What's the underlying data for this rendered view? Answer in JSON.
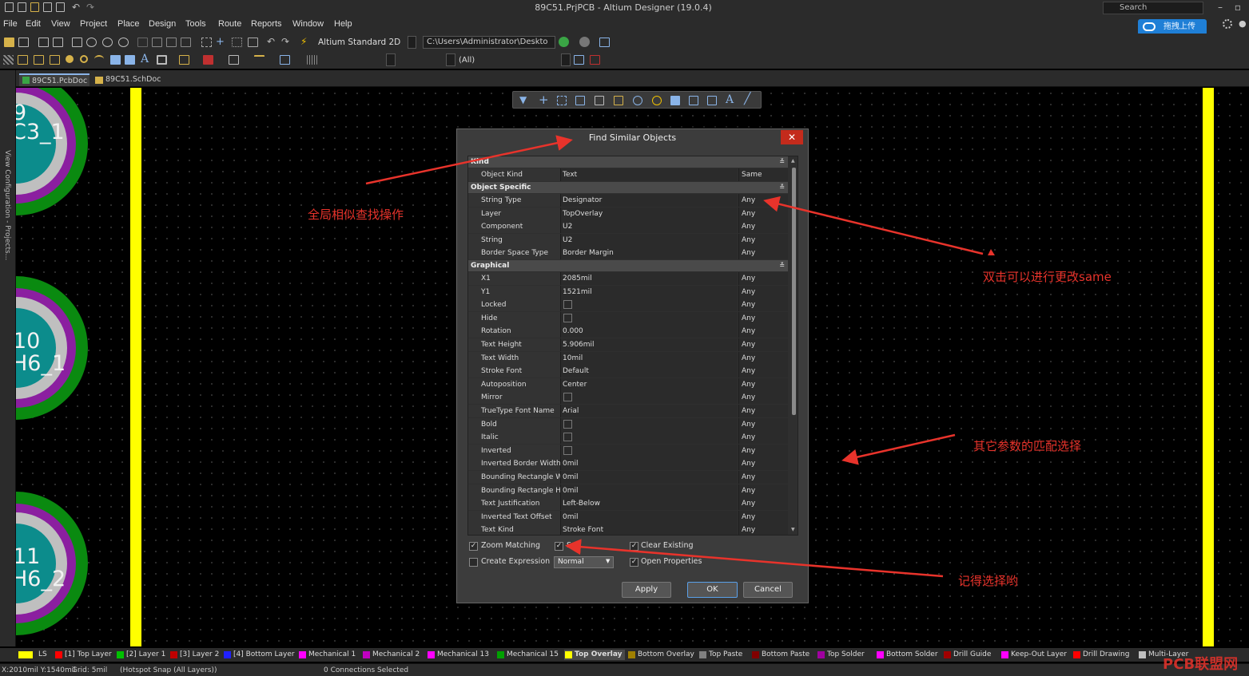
{
  "window": {
    "title": "89C51.PrjPCB - Altium Designer (19.0.4)",
    "search_placeholder": "Search",
    "cloud_button": "拖拽上传"
  },
  "menu": [
    "File",
    "Edit",
    "View",
    "Project",
    "Place",
    "Design",
    "Tools",
    "Route",
    "Reports",
    "Window",
    "Help"
  ],
  "toolbar": {
    "view_mode": "Altium Standard 2D",
    "path": "C:\\Users\\Administrator\\Deskto",
    "filter": "(All)"
  },
  "tabs": [
    "89C51.PcbDoc *",
    "89C51.SchDoc"
  ],
  "side_panel": {
    "label": "View Configuration - Projects..."
  },
  "pads": [
    {
      "line1": "9",
      "line2": "C3_1"
    },
    {
      "line1": "10",
      "line2": "H6_1"
    },
    {
      "line1": "11",
      "line2": "H6_2"
    }
  ],
  "dialog": {
    "title": "Find Similar Objects",
    "close": "✕",
    "sections": {
      "kind": "Kind",
      "specific": "Object Specific",
      "graphical": "Graphical"
    },
    "kind_rows": [
      {
        "label": "Object Kind",
        "value": "Text",
        "match": "Same"
      }
    ],
    "specific_rows": [
      {
        "label": "String Type",
        "value": "Designator",
        "match": "Any"
      },
      {
        "label": "Layer",
        "value": "TopOverlay",
        "match": "Any"
      },
      {
        "label": "Component",
        "value": "U2",
        "match": "Any"
      },
      {
        "label": "String",
        "value": "U2",
        "match": "Any"
      },
      {
        "label": "Border Space Type",
        "value": "Border Margin",
        "match": "Any"
      }
    ],
    "graphical_rows": [
      {
        "label": "X1",
        "value": "2085mil",
        "match": "Any"
      },
      {
        "label": "Y1",
        "value": "1521mil",
        "match": "Any"
      },
      {
        "label": "Locked",
        "value": "",
        "match": "Any"
      },
      {
        "label": "Hide",
        "value": "",
        "match": "Any"
      },
      {
        "label": "Rotation",
        "value": "0.000",
        "match": "Any"
      },
      {
        "label": "Text Height",
        "value": "5.906mil",
        "match": "Any"
      },
      {
        "label": "Text Width",
        "value": "10mil",
        "match": "Any"
      },
      {
        "label": "Stroke Font",
        "value": "Default",
        "match": "Any"
      },
      {
        "label": "Autoposition",
        "value": "Center",
        "match": "Any"
      },
      {
        "label": "Mirror",
        "value": "",
        "match": "Any"
      },
      {
        "label": "TrueType Font Name",
        "value": "Arial",
        "match": "Any"
      },
      {
        "label": "Bold",
        "value": "",
        "match": "Any"
      },
      {
        "label": "Italic",
        "value": "",
        "match": "Any"
      },
      {
        "label": "Inverted",
        "value": "",
        "match": "Any"
      },
      {
        "label": "Inverted Border Width",
        "value": "0mil",
        "match": "Any"
      },
      {
        "label": "Bounding Rectangle W",
        "value": "0mil",
        "match": "Any"
      },
      {
        "label": "Bounding Rectangle H",
        "value": "0mil",
        "match": "Any"
      },
      {
        "label": "Text Justification",
        "value": "Left-Below",
        "match": "Any"
      },
      {
        "label": "Inverted Text Offset",
        "value": "0mil",
        "match": "Any"
      },
      {
        "label": "Text Kind",
        "value": "Stroke Font",
        "match": "Any"
      }
    ],
    "options": {
      "zoom_matching": "Zoom Matching",
      "select_matched": "S",
      "clear_existing": "Clear Existing",
      "create_expression": "Create Expression",
      "open_properties": "Open Properties",
      "mask_mode": "Normal"
    },
    "buttons": {
      "apply": "Apply",
      "ok": "OK",
      "cancel": "Cancel"
    }
  },
  "annotations": {
    "a1": "全局相似查找操作",
    "a2": "双击可以进行更改same",
    "a3": "其它参数的匹配选择",
    "a4": "记得选择哟"
  },
  "layers": [
    {
      "name": "LS",
      "color": "#ffff00"
    },
    {
      "name": "[1] Top Layer",
      "color": "#ff0000"
    },
    {
      "name": "[2] Layer 1",
      "color": "#00c000"
    },
    {
      "name": "[3] Layer 2",
      "color": "#c00000"
    },
    {
      "name": "[4] Bottom Layer",
      "color": "#2020ff"
    },
    {
      "name": "Mechanical 1",
      "color": "#ff00ff"
    },
    {
      "name": "Mechanical 2",
      "color": "#c000c0"
    },
    {
      "name": "Mechanical 13",
      "color": "#ff00ff"
    },
    {
      "name": "Mechanical 15",
      "color": "#00a000"
    },
    {
      "name": "Top Overlay",
      "color": "#ffff00"
    },
    {
      "name": "Bottom Overlay",
      "color": "#a08000"
    },
    {
      "name": "Top Paste",
      "color": "#808080"
    },
    {
      "name": "Bottom Paste",
      "color": "#800000"
    },
    {
      "name": "Top Solder",
      "color": "#a000a0"
    },
    {
      "name": "Bottom Solder",
      "color": "#ff00ff"
    },
    {
      "name": "Drill Guide",
      "color": "#a00000"
    },
    {
      "name": "Keep-Out Layer",
      "color": "#ff00ff"
    },
    {
      "name": "Drill Drawing",
      "color": "#ff0000"
    },
    {
      "name": "Multi-Layer",
      "color": "#c0c0c0"
    }
  ],
  "status": {
    "coords": "X:2010mil Y:1540mil",
    "grid": "Grid: 5mil",
    "snap": "(Hotspot Snap (All Layers))",
    "connections": "0 Connections Selected"
  },
  "watermark": "PCB联盟网"
}
